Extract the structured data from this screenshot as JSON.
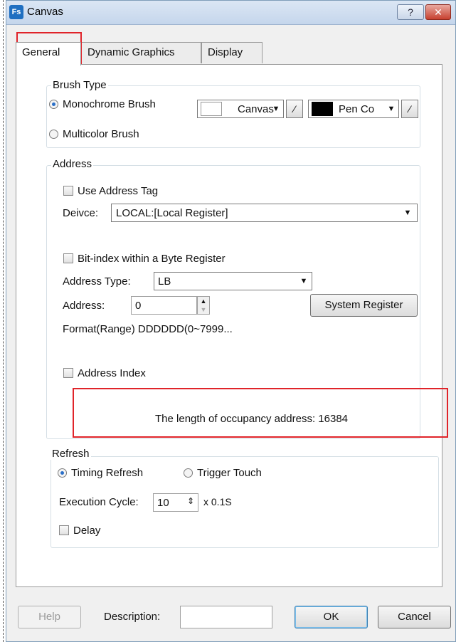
{
  "window": {
    "title": "Canvas",
    "icon": "Fs",
    "help_glyph": "?",
    "close_glyph": "✕"
  },
  "tabs": [
    {
      "label": "General"
    },
    {
      "label": "Dynamic Graphics"
    },
    {
      "label": "Display"
    }
  ],
  "brush_type": {
    "title": "Brush Type",
    "monochrome_label": "Monochrome Brush",
    "multicolor_label": "Multicolor Brush",
    "canvas_color_label": "Canvas",
    "pen_color_label": "Pen Co",
    "canvas_color": "#ffffff",
    "pen_color": "#000000"
  },
  "address": {
    "title": "Address",
    "use_tag_label": "Use Address Tag",
    "device_label": "Deivce:",
    "device_value": "LOCAL:[Local Register]",
    "bit_index_label": "Bit-index within a Byte Register",
    "address_type_label": "Address Type:",
    "address_type_value": "LB",
    "address_label": "Address:",
    "address_value": "0",
    "system_register_label": "System Register",
    "format_text": "Format(Range) DDDDDD(0~7999...",
    "address_index_label": "Address Index",
    "occupancy_text": "The length of occupancy address:  16384"
  },
  "refresh": {
    "title": "Refresh",
    "timing_label": "Timing Refresh",
    "trigger_label": "Trigger Touch",
    "cycle_label": "Execution Cycle:",
    "cycle_value": "10",
    "cycle_unit": "x 0.1S",
    "delay_label": "Delay"
  },
  "footer": {
    "help_label": "Help",
    "description_label": "Description:",
    "description_value": "",
    "ok_label": "OK",
    "cancel_label": "Cancel"
  },
  "colors": {
    "highlight": "#e0242a",
    "accent": "#2a6fc8"
  }
}
